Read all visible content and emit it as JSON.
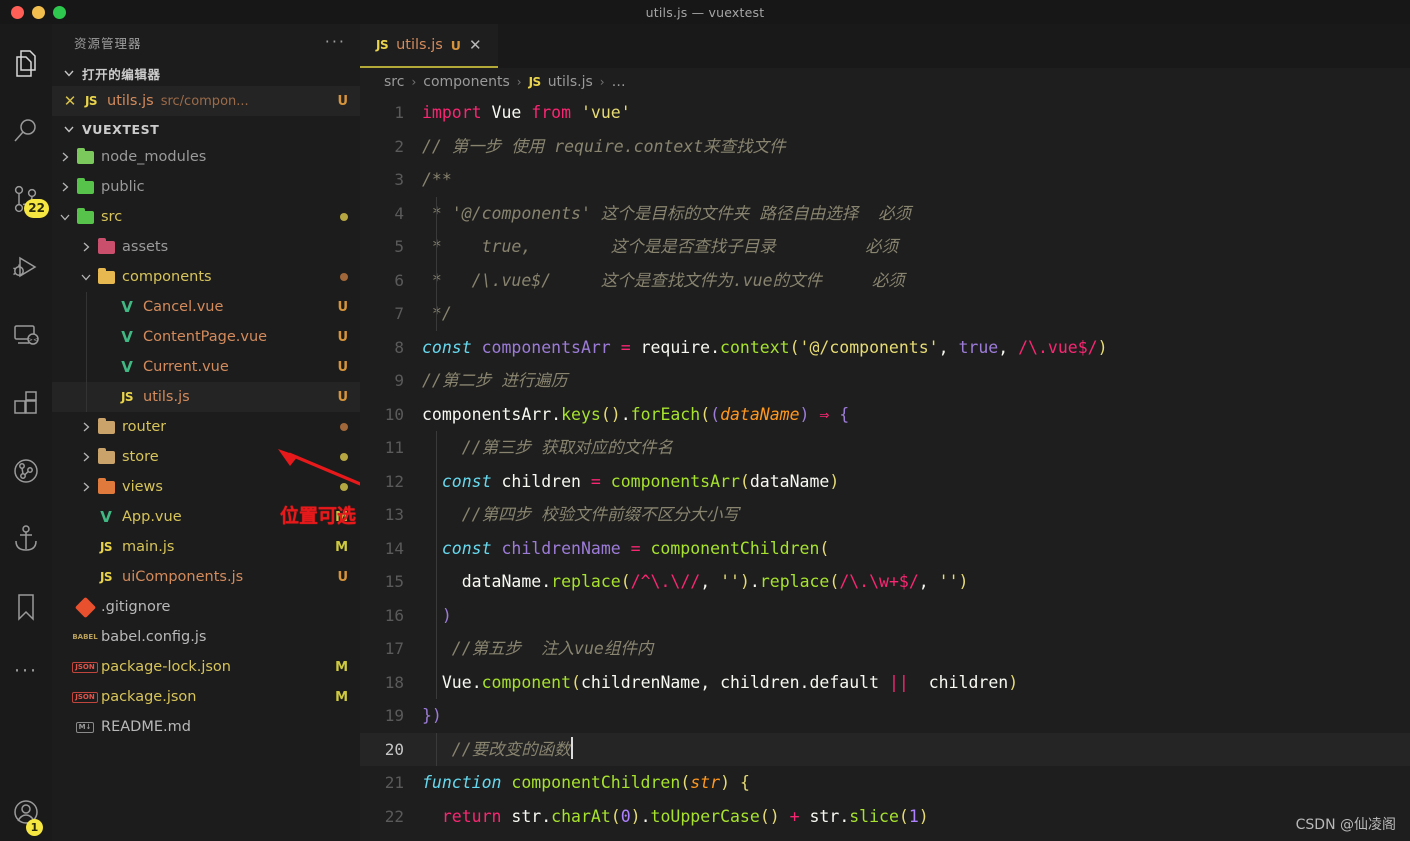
{
  "window": {
    "title": "utils.js — vuextest",
    "traffic_lights": [
      "close",
      "minimize",
      "zoom"
    ]
  },
  "activity_bar": {
    "items": [
      {
        "name": "explorer",
        "icon": "files-icon",
        "active": true,
        "badge": ""
      },
      {
        "name": "search",
        "icon": "search-icon",
        "active": false,
        "badge": ""
      },
      {
        "name": "source-control",
        "icon": "source-control-icon",
        "active": false,
        "badge": "22"
      },
      {
        "name": "run-and-debug",
        "icon": "run-debug-icon",
        "active": false,
        "badge": ""
      },
      {
        "name": "remote-explorer",
        "icon": "remote-explorer-icon",
        "active": false,
        "badge": ""
      },
      {
        "name": "extensions",
        "icon": "extensions-icon",
        "active": false,
        "badge": ""
      },
      {
        "name": "gitlens",
        "icon": "gitlens-icon",
        "active": false,
        "badge": ""
      },
      {
        "name": "docker",
        "icon": "anchor-icon",
        "active": false,
        "badge": ""
      },
      {
        "name": "bookmarks",
        "icon": "bookmark-icon",
        "active": false,
        "badge": ""
      }
    ],
    "more_label": "···",
    "account": {
      "icon": "account-icon",
      "badge": "1"
    }
  },
  "sidebar": {
    "header_title": "资源管理器",
    "more_actions": "···",
    "open_editors": {
      "label": "打开的编辑器",
      "expanded": true,
      "items": [
        {
          "close": "✕",
          "badge": "JS",
          "name": "utils.js",
          "path": "src/compon...",
          "git": "U"
        }
      ]
    },
    "workspace": {
      "label": "VUEXTEST",
      "expanded": true,
      "tree": [
        {
          "name": "node_modules",
          "type": "folder",
          "icon": "folder-node-modules",
          "depth": 1,
          "expanded": false,
          "git": "",
          "dot": ""
        },
        {
          "name": "public",
          "type": "folder",
          "icon": "folder-public",
          "depth": 1,
          "expanded": false,
          "git": "",
          "dot": ""
        },
        {
          "name": "src",
          "type": "folder",
          "icon": "folder-src",
          "depth": 1,
          "expanded": true,
          "git": "",
          "dot": "#b5a642"
        },
        {
          "name": "assets",
          "type": "folder",
          "icon": "folder-assets",
          "depth": 2,
          "expanded": false,
          "git": "",
          "dot": ""
        },
        {
          "name": "components",
          "type": "folder",
          "icon": "folder-components",
          "depth": 2,
          "expanded": true,
          "git": "",
          "dot": "#a0673a"
        },
        {
          "name": "Cancel.vue",
          "type": "file",
          "icon": "vue-icon",
          "depth": 3,
          "git": "U",
          "dot": ""
        },
        {
          "name": "ContentPage.vue",
          "type": "file",
          "icon": "vue-icon",
          "depth": 3,
          "git": "U",
          "dot": ""
        },
        {
          "name": "Current.vue",
          "type": "file",
          "icon": "vue-icon",
          "depth": 3,
          "git": "U",
          "dot": ""
        },
        {
          "name": "utils.js",
          "type": "file",
          "icon": "js-icon",
          "depth": 3,
          "git": "U",
          "dot": "",
          "selected": true
        },
        {
          "name": "router",
          "type": "folder",
          "icon": "folder-router",
          "depth": 2,
          "expanded": false,
          "git": "",
          "dot": "#a0673a"
        },
        {
          "name": "store",
          "type": "folder",
          "icon": "folder-store",
          "depth": 2,
          "expanded": false,
          "git": "",
          "dot": "#b5a642"
        },
        {
          "name": "views",
          "type": "folder",
          "icon": "folder-views",
          "depth": 2,
          "expanded": false,
          "git": "",
          "dot": "#b5a642"
        },
        {
          "name": "App.vue",
          "type": "file",
          "icon": "vue-icon",
          "depth": 2,
          "git": "M",
          "dot": ""
        },
        {
          "name": "main.js",
          "type": "file",
          "icon": "js-icon",
          "depth": 2,
          "git": "M",
          "dot": ""
        },
        {
          "name": "uiComponents.js",
          "type": "file",
          "icon": "js-icon",
          "depth": 2,
          "git": "U",
          "dot": ""
        },
        {
          "name": ".gitignore",
          "type": "file",
          "icon": "git-icon",
          "depth": 1,
          "git": "",
          "dot": ""
        },
        {
          "name": "babel.config.js",
          "type": "file",
          "icon": "babel-icon",
          "depth": 1,
          "git": "",
          "dot": ""
        },
        {
          "name": "package-lock.json",
          "type": "file",
          "icon": "json-icon",
          "depth": 1,
          "git": "M",
          "dot": ""
        },
        {
          "name": "package.json",
          "type": "file",
          "icon": "json-icon",
          "depth": 1,
          "git": "M",
          "dot": ""
        },
        {
          "name": "README.md",
          "type": "file",
          "icon": "markdown-icon",
          "depth": 1,
          "git": "",
          "dot": ""
        }
      ]
    },
    "annotation": {
      "text": "位置可选",
      "color": "#e8191b",
      "arrow": "points-to-utils-js"
    }
  },
  "editor": {
    "tabs": [
      {
        "badge": "JS",
        "name": "utils.js",
        "git": "U",
        "close": "✕",
        "active": true
      }
    ],
    "breadcrumbs": [
      {
        "text": "src",
        "icon": ""
      },
      {
        "text": "components",
        "icon": ""
      },
      {
        "text": "utils.js",
        "icon": "js-icon"
      },
      {
        "text": "…",
        "icon": ""
      }
    ],
    "breadcrumb_separator": "›",
    "active_line": 20,
    "cursor_line": 20,
    "lines": [
      {
        "n": 1,
        "tokens": [
          {
            "t": "import",
            "c": "t-kw"
          },
          {
            "t": " ",
            "c": "t-white"
          },
          {
            "t": "Vue",
            "c": "t-white"
          },
          {
            "t": " ",
            "c": "t-white"
          },
          {
            "t": "from",
            "c": "t-kw"
          },
          {
            "t": " ",
            "c": "t-white"
          },
          {
            "t": "'vue'",
            "c": "t-str"
          }
        ]
      },
      {
        "n": 2,
        "tokens": [
          {
            "t": "// 第一步 使用 require.context来查找文件",
            "c": "t-cmt"
          }
        ]
      },
      {
        "n": 3,
        "tokens": [
          {
            "t": "/**",
            "c": "t-cmt"
          }
        ]
      },
      {
        "n": 4,
        "tokens": [
          {
            "t": " * '@/components' 这个是目标的文件夹 路径自由选择  必须",
            "c": "t-cmt"
          }
        ]
      },
      {
        "n": 5,
        "tokens": [
          {
            "t": " *    true,        这个是是否查找子目录         必须",
            "c": "t-cmt"
          }
        ]
      },
      {
        "n": 6,
        "tokens": [
          {
            "t": " *   /\\.vue$/     这个是查找文件为.vue的文件     必须",
            "c": "t-cmt"
          }
        ]
      },
      {
        "n": 7,
        "tokens": [
          {
            "t": " */",
            "c": "t-cmt"
          }
        ]
      },
      {
        "n": 8,
        "tokens": [
          {
            "t": "const",
            "c": "t-const"
          },
          {
            "t": " componentsArr ",
            "c": "t-prop"
          },
          {
            "t": "=",
            "c": "t-op"
          },
          {
            "t": " ",
            "c": "t-white"
          },
          {
            "t": "require",
            "c": "t-white"
          },
          {
            "t": ".",
            "c": "t-white"
          },
          {
            "t": "context",
            "c": "t-fn"
          },
          {
            "t": "(",
            "c": "t-paren1"
          },
          {
            "t": "'@/components'",
            "c": "t-str"
          },
          {
            "t": ", ",
            "c": "t-white"
          },
          {
            "t": "true",
            "c": "t-bool"
          },
          {
            "t": ", ",
            "c": "t-white"
          },
          {
            "t": "/\\.vue$/",
            "c": "t-regex"
          },
          {
            "t": ")",
            "c": "t-paren1"
          }
        ]
      },
      {
        "n": 9,
        "tokens": [
          {
            "t": "//第二步 进行遍历",
            "c": "t-cmt"
          }
        ]
      },
      {
        "n": 10,
        "tokens": [
          {
            "t": "componentsArr",
            "c": "t-white"
          },
          {
            "t": ".",
            "c": "t-white"
          },
          {
            "t": "keys",
            "c": "t-fn"
          },
          {
            "t": "()",
            "c": "t-paren1"
          },
          {
            "t": ".",
            "c": "t-white"
          },
          {
            "t": "forEach",
            "c": "t-fn"
          },
          {
            "t": "(",
            "c": "t-paren1"
          },
          {
            "t": "(",
            "c": "t-paren2"
          },
          {
            "t": "dataName",
            "c": "t-param"
          },
          {
            "t": ")",
            "c": "t-paren2"
          },
          {
            "t": " ⇒ ",
            "c": "t-op"
          },
          {
            "t": "{",
            "c": "t-paren2"
          }
        ]
      },
      {
        "n": 11,
        "tokens": [
          {
            "t": "    //第三步 获取对应的文件名",
            "c": "t-cmt"
          }
        ]
      },
      {
        "n": 12,
        "tokens": [
          {
            "t": "  ",
            "c": "t-white"
          },
          {
            "t": "const",
            "c": "t-const"
          },
          {
            "t": " children ",
            "c": "t-white"
          },
          {
            "t": "=",
            "c": "t-op"
          },
          {
            "t": " ",
            "c": "t-white"
          },
          {
            "t": "componentsArr",
            "c": "t-fn"
          },
          {
            "t": "(",
            "c": "t-paren1"
          },
          {
            "t": "dataName",
            "c": "t-white"
          },
          {
            "t": ")",
            "c": "t-paren1"
          }
        ]
      },
      {
        "n": 13,
        "tokens": [
          {
            "t": "    //第四步 校验文件前缀不区分大小写",
            "c": "t-cmt"
          }
        ]
      },
      {
        "n": 14,
        "tokens": [
          {
            "t": "  ",
            "c": "t-white"
          },
          {
            "t": "const",
            "c": "t-const"
          },
          {
            "t": " childrenName ",
            "c": "t-prop"
          },
          {
            "t": "=",
            "c": "t-op"
          },
          {
            "t": " ",
            "c": "t-white"
          },
          {
            "t": "componentChildren",
            "c": "t-fn"
          },
          {
            "t": "(",
            "c": "t-paren1"
          }
        ]
      },
      {
        "n": 15,
        "tokens": [
          {
            "t": "    ",
            "c": "t-white"
          },
          {
            "t": "dataName",
            "c": "t-white"
          },
          {
            "t": ".",
            "c": "t-white"
          },
          {
            "t": "replace",
            "c": "t-fn"
          },
          {
            "t": "(",
            "c": "t-paren1"
          },
          {
            "t": "/^\\.\\//",
            "c": "t-regex"
          },
          {
            "t": ", ",
            "c": "t-white"
          },
          {
            "t": "''",
            "c": "t-str"
          },
          {
            "t": ")",
            "c": "t-paren1"
          },
          {
            "t": ".",
            "c": "t-white"
          },
          {
            "t": "replace",
            "c": "t-fn"
          },
          {
            "t": "(",
            "c": "t-paren1"
          },
          {
            "t": "/\\.\\w+$/",
            "c": "t-regex"
          },
          {
            "t": ", ",
            "c": "t-white"
          },
          {
            "t": "''",
            "c": "t-str"
          },
          {
            "t": ")",
            "c": "t-paren1"
          }
        ]
      },
      {
        "n": 16,
        "tokens": [
          {
            "t": "  )",
            "c": "t-paren2"
          }
        ]
      },
      {
        "n": 17,
        "tokens": [
          {
            "t": "   //第五步  注入vue组件内",
            "c": "t-cmt"
          }
        ]
      },
      {
        "n": 18,
        "tokens": [
          {
            "t": "  ",
            "c": "t-white"
          },
          {
            "t": "Vue",
            "c": "t-white"
          },
          {
            "t": ".",
            "c": "t-white"
          },
          {
            "t": "component",
            "c": "t-fn"
          },
          {
            "t": "(",
            "c": "t-paren1"
          },
          {
            "t": "childrenName",
            "c": "t-white"
          },
          {
            "t": ", ",
            "c": "t-white"
          },
          {
            "t": "children",
            "c": "t-white"
          },
          {
            "t": ".",
            "c": "t-white"
          },
          {
            "t": "default",
            "c": "t-white"
          },
          {
            "t": " ",
            "c": "t-white"
          },
          {
            "t": "||",
            "c": "t-op"
          },
          {
            "t": "  ",
            "c": "t-white"
          },
          {
            "t": "children",
            "c": "t-white"
          },
          {
            "t": ")",
            "c": "t-paren1"
          }
        ]
      },
      {
        "n": 19,
        "tokens": [
          {
            "t": "})",
            "c": "t-paren2"
          }
        ]
      },
      {
        "n": 20,
        "tokens": [
          {
            "t": "   //要改变的函数",
            "c": "t-cmt"
          }
        ],
        "cursor": true
      },
      {
        "n": 21,
        "tokens": [
          {
            "t": "function",
            "c": "t-const"
          },
          {
            "t": " ",
            "c": "t-white"
          },
          {
            "t": "componentChildren",
            "c": "t-fn"
          },
          {
            "t": "(",
            "c": "t-paren1"
          },
          {
            "t": "str",
            "c": "t-param"
          },
          {
            "t": ")",
            "c": "t-paren1"
          },
          {
            "t": " ",
            "c": "t-white"
          },
          {
            "t": "{",
            "c": "t-paren1"
          }
        ]
      },
      {
        "n": 22,
        "tokens": [
          {
            "t": "  ",
            "c": "t-white"
          },
          {
            "t": "return",
            "c": "t-kw"
          },
          {
            "t": " ",
            "c": "t-white"
          },
          {
            "t": "str",
            "c": "t-white"
          },
          {
            "t": ".",
            "c": "t-white"
          },
          {
            "t": "charAt",
            "c": "t-fn"
          },
          {
            "t": "(",
            "c": "t-paren1"
          },
          {
            "t": "0",
            "c": "t-num"
          },
          {
            "t": ")",
            "c": "t-paren1"
          },
          {
            "t": ".",
            "c": "t-white"
          },
          {
            "t": "toUpperCase",
            "c": "t-fn"
          },
          {
            "t": "()",
            "c": "t-paren1"
          },
          {
            "t": " ",
            "c": "t-white"
          },
          {
            "t": "+",
            "c": "t-op"
          },
          {
            "t": " ",
            "c": "t-white"
          },
          {
            "t": "str",
            "c": "t-white"
          },
          {
            "t": ".",
            "c": "t-white"
          },
          {
            "t": "slice",
            "c": "t-fn"
          },
          {
            "t": "(",
            "c": "t-paren1"
          },
          {
            "t": "1",
            "c": "t-num"
          },
          {
            "t": ")",
            "c": "t-paren1"
          }
        ]
      }
    ]
  },
  "watermark": "CSDN @仙凌阁"
}
